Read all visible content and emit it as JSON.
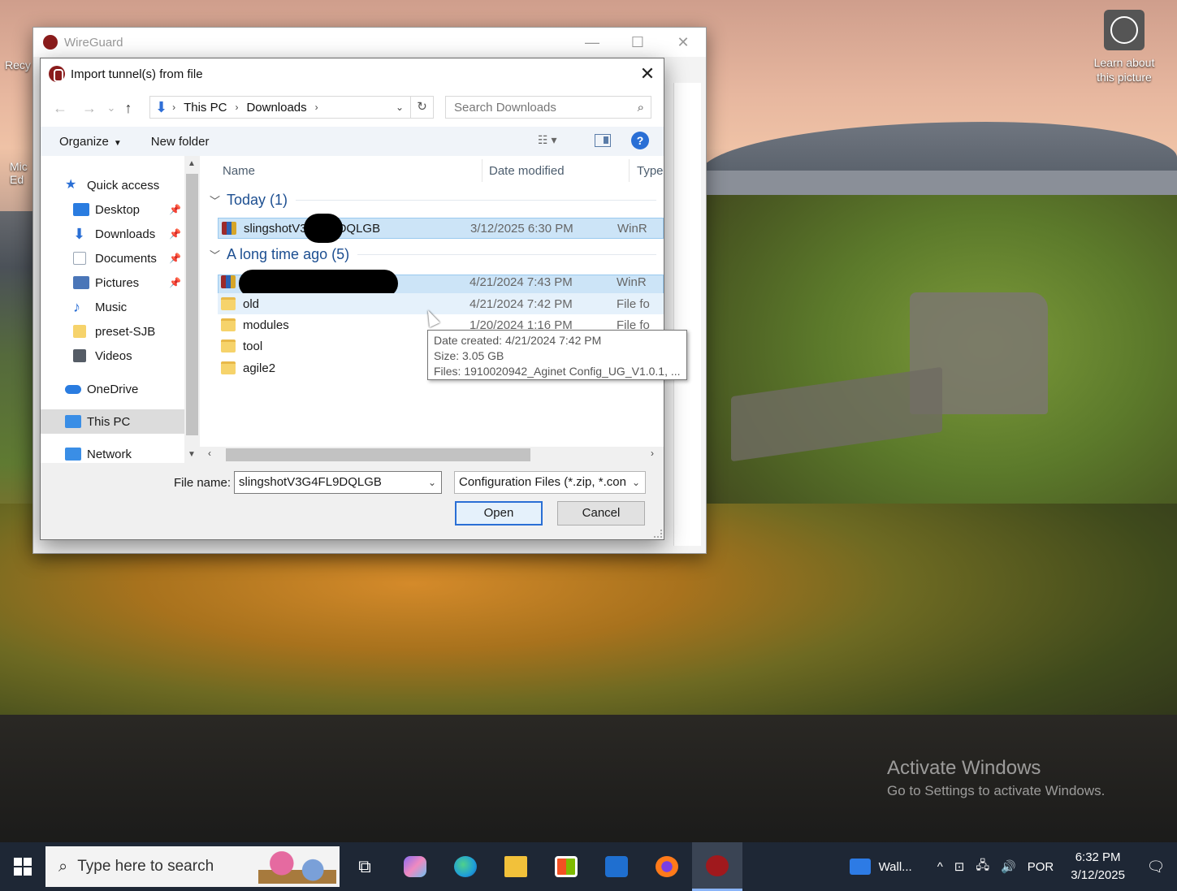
{
  "desktop": {
    "recycle_label": "Recy",
    "edge_label_1": "Mic",
    "edge_label_2": "Ed",
    "learn_label": "Learn about this picture",
    "watermark_title": "Activate Windows",
    "watermark_sub": "Go to Settings to activate Windows."
  },
  "main_window": {
    "title": "WireGuard",
    "minimize": "—",
    "maximize": "☐",
    "close": "✕"
  },
  "dialog": {
    "title": "Import tunnel(s) from file",
    "close": "✕",
    "nav": {
      "back": "←",
      "forward": "→",
      "recent": "⌄",
      "up": "↑"
    },
    "address": {
      "crumbs": [
        "This PC",
        "Downloads"
      ],
      "sep": "›",
      "dropdown": "⌄",
      "refresh": "↻"
    },
    "search": {
      "placeholder": "Search Downloads",
      "icon": "⌕"
    },
    "toolbar": {
      "organize": "Organize",
      "organize_caret": "▼",
      "new_folder": "New folder",
      "view_glyph": "☷ ▾",
      "help": "?"
    },
    "nav_pane": [
      {
        "label": "Quick access",
        "icon": "star-icon",
        "color": "#2a6fd5",
        "pinned": false
      },
      {
        "label": "Desktop",
        "icon": "desktop-icon",
        "color": "#2a7ce0",
        "pinned": true
      },
      {
        "label": "Downloads",
        "icon": "downloads-icon",
        "color": "#2a6fd5",
        "pinned": true
      },
      {
        "label": "Documents",
        "icon": "documents-icon",
        "color": "#9aa6b5",
        "pinned": true
      },
      {
        "label": "Pictures",
        "icon": "pictures-icon",
        "color": "#4a76b8",
        "pinned": true
      },
      {
        "label": "Music",
        "icon": "music-icon",
        "color": "#2a6fd5",
        "pinned": false
      },
      {
        "label": "preset-SJB",
        "icon": "folder-icon",
        "color": "#f6d36b",
        "pinned": false
      },
      {
        "label": "Videos",
        "icon": "videos-icon",
        "color": "#555c66",
        "pinned": false
      },
      {
        "label": "OneDrive",
        "icon": "cloud-icon",
        "color": "#2a7ce0",
        "pinned": false
      },
      {
        "label": "This PC",
        "icon": "computer-icon",
        "color": "#3a8ee6",
        "pinned": false
      },
      {
        "label": "Network",
        "icon": "network-icon",
        "color": "#3a8ee6",
        "pinned": false
      }
    ],
    "pin_glyph": "📌",
    "columns": [
      "Name",
      "Date modified",
      "Type"
    ],
    "groups": [
      {
        "label": "Today (1)",
        "chevron": "﹀"
      },
      {
        "label": "A long time ago (5)",
        "chevron": "﹀"
      }
    ],
    "files": [
      {
        "name": "slingshotV3",
        "name_tail": "DQLGB",
        "date": "3/12/2025 6:30 PM",
        "type": "WinR",
        "kind": "rar"
      },
      {
        "name": "",
        "name_tail": "",
        "date": "4/21/2024 7:43 PM",
        "type": "WinR",
        "kind": "rar"
      },
      {
        "name": "old",
        "name_tail": "",
        "date": "4/21/2024 7:42 PM",
        "type": "File fo",
        "kind": "folder"
      },
      {
        "name": "modules",
        "name_tail": "",
        "date": "1/20/2024 1:16 PM",
        "type": "File fo",
        "kind": "folder"
      },
      {
        "name": "tool",
        "name_tail": "",
        "date": "",
        "type": "",
        "kind": "folder"
      },
      {
        "name": "agile2",
        "name_tail": "",
        "date": "",
        "type": "",
        "kind": "folder"
      }
    ],
    "tooltip": {
      "line1": "Date created: 4/21/2024 7:42 PM",
      "line2": "Size: 3.05 GB",
      "line3": "Files: 1910020942_Aginet Config_UG_V1.0.1, ..."
    },
    "scroll": {
      "left": "‹",
      "right": "›",
      "up": "▲",
      "down": "▼"
    },
    "file_name_label": "File name:",
    "file_name_value": "slingshotV3G4FL9DQLGB",
    "filter_value": "Configuration Files (*.zip, *.con",
    "dropdown_glyph": "⌄",
    "open_button": "Open",
    "cancel_button": "Cancel"
  },
  "taskbar": {
    "search_placeholder": "Type here to search",
    "search_icon": "⌕",
    "taskview_glyph": "⧉",
    "apps": [
      {
        "name": "copilot-icon",
        "color": "#8a6cf0"
      },
      {
        "name": "edge-icon",
        "color": "#1f9fd8"
      },
      {
        "name": "file-explorer-icon",
        "color": "#f2c13a"
      },
      {
        "name": "store-icon",
        "color": "#2a6fd5"
      },
      {
        "name": "outlook-icon",
        "color": "#1f6fd0"
      },
      {
        "name": "firefox-icon",
        "color": "#ff7a1a"
      },
      {
        "name": "wireguard-icon",
        "color": "#a0191d"
      }
    ],
    "widget_label": "Wall...",
    "tray_chevron": "^",
    "tray_glyphs": [
      "⊡",
      "🖧",
      "🔊"
    ],
    "language": "POR",
    "time": "6:32 PM",
    "date": "3/12/2025",
    "notif_glyph": "🗨"
  }
}
